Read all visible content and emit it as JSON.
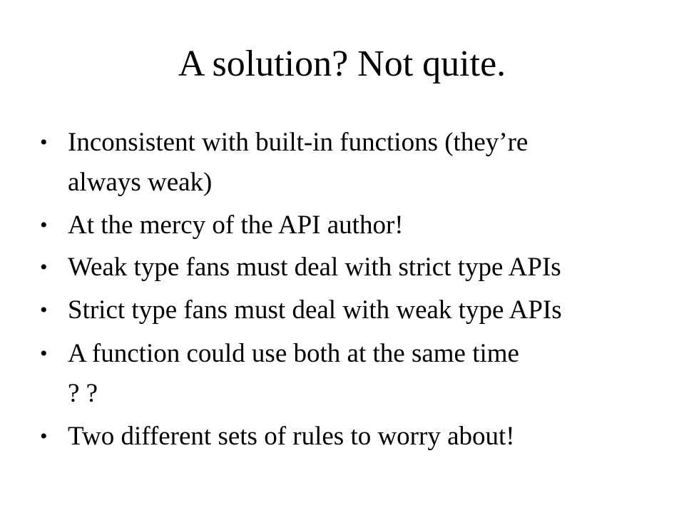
{
  "slide": {
    "title": "A solution? Not quite.",
    "bullet_symbol": "•",
    "bullets": [
      {
        "lines": [
          "Inconsistent with built-in functions (they’re",
          "always weak)"
        ]
      },
      {
        "lines": [
          "At the mercy of the API author!"
        ]
      },
      {
        "lines": [
          "Weak type fans must deal with strict type APIs"
        ]
      },
      {
        "lines": [
          "Strict type fans must deal with weak type APIs"
        ]
      },
      {
        "lines": [
          "A function could use both at the same time",
          "? ?"
        ]
      },
      {
        "lines": [
          "Two different sets of rules to worry about!"
        ]
      }
    ]
  }
}
